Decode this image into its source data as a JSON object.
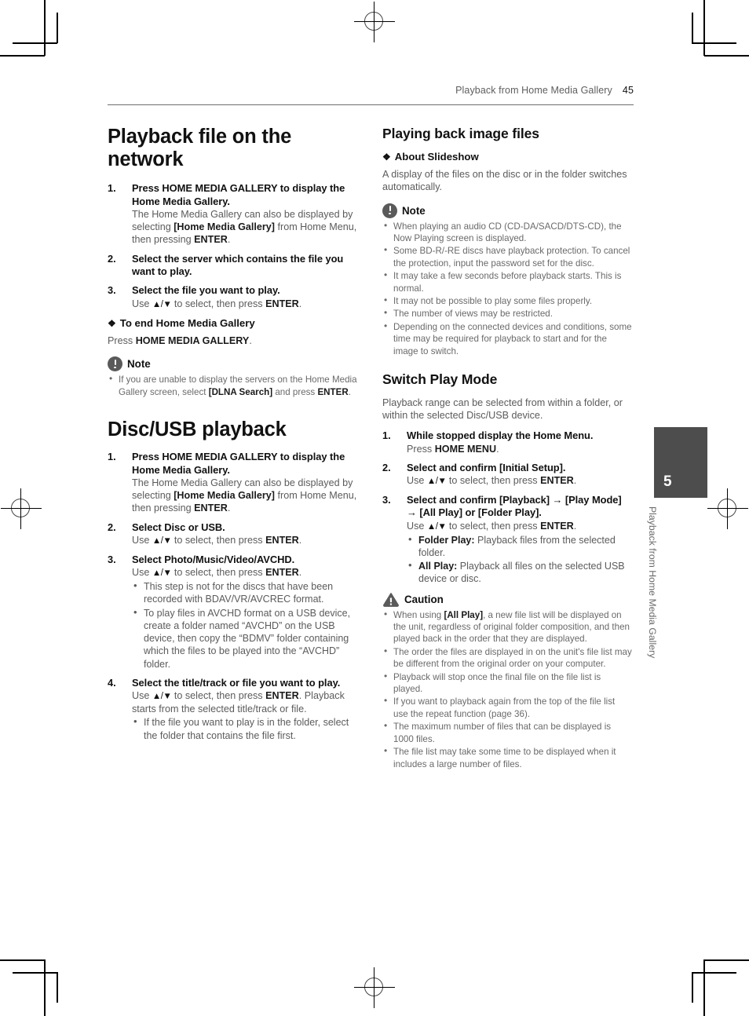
{
  "header": {
    "chapter_title": "Playback from Home Media Gallery",
    "page_number": "45"
  },
  "side_tab": {
    "chapter_number": "5",
    "chapter_label": "Playback from Home Media Gallery",
    "color": "#4d4d4d"
  },
  "left_column": {
    "heading_network": "Playback file on the network",
    "steps_network": [
      {
        "num": "1.",
        "title": "Press HOME MEDIA GALLERY to display the Home Media Gallery.",
        "body_parts": [
          {
            "t": "The Home Media Gallery can also be displayed by selecting ",
            "b": false
          },
          {
            "t": "[Home Media Gallery]",
            "b": true
          },
          {
            "t": " from Home Menu, then pressing ",
            "b": false
          },
          {
            "t": "ENTER",
            "b": true
          },
          {
            "t": ".",
            "b": false
          }
        ]
      },
      {
        "num": "2.",
        "title": "Select the server which contains the file you want to play.",
        "body_parts": []
      },
      {
        "num": "3.",
        "title": "Select the file you want to play.",
        "body_parts": [
          {
            "t": "Use ",
            "b": false
          },
          {
            "t": "ARROWS",
            "b": false,
            "arrows": true
          },
          {
            "t": " to select, then press ",
            "b": false
          },
          {
            "t": "ENTER",
            "b": true
          },
          {
            "t": ".",
            "b": false
          }
        ]
      }
    ],
    "to_end_heading": "To end Home Media Gallery",
    "to_end_body_parts": [
      {
        "t": "Press ",
        "b": false
      },
      {
        "t": "HOME MEDIA GALLERY",
        "b": true
      },
      {
        "t": ".",
        "b": false
      }
    ],
    "note_label": "Note",
    "note_items": [
      [
        {
          "t": "If you are unable to display the servers on the Home Media Gallery screen, select ",
          "b": false
        },
        {
          "t": "[DLNA Search]",
          "b": true
        },
        {
          "t": " and press ",
          "b": false
        },
        {
          "t": "ENTER",
          "b": true
        },
        {
          "t": ".",
          "b": false
        }
      ]
    ],
    "heading_discusb": "Disc/USB playback",
    "steps_discusb": [
      {
        "num": "1.",
        "title": "Press HOME MEDIA GALLERY to display the Home Media Gallery.",
        "body_parts": [
          {
            "t": "The Home Media Gallery can also be displayed by selecting ",
            "b": false
          },
          {
            "t": "[Home Media Gallery]",
            "b": true
          },
          {
            "t": " from Home Menu, then pressing ",
            "b": false
          },
          {
            "t": "ENTER",
            "b": true
          },
          {
            "t": ".",
            "b": false
          }
        ],
        "bullets": []
      },
      {
        "num": "2.",
        "title": "Select Disc or USB.",
        "body_parts": [
          {
            "t": "Use ",
            "b": false
          },
          {
            "t": "ARROWS",
            "b": false,
            "arrows": true
          },
          {
            "t": " to select, then press ",
            "b": false
          },
          {
            "t": "ENTER",
            "b": true
          },
          {
            "t": ".",
            "b": false
          }
        ],
        "bullets": []
      },
      {
        "num": "3.",
        "title": "Select Photo/Music/Video/AVCHD.",
        "body_parts": [
          {
            "t": "Use ",
            "b": false
          },
          {
            "t": "ARROWS",
            "b": false,
            "arrows": true
          },
          {
            "t": " to select, then press ",
            "b": false
          },
          {
            "t": "ENTER",
            "b": true
          },
          {
            "t": ".",
            "b": false
          }
        ],
        "bullets": [
          [
            {
              "t": "This step is not for the discs that have been recorded with BDAV/VR/AVCREC format.",
              "b": false
            }
          ],
          [
            {
              "t": "To play files in AVCHD format on a USB device, create a folder named “AVCHD” on the USB device, then copy the “BDMV” folder containing which the files to be played into the “AVCHD” folder.",
              "b": false
            }
          ]
        ]
      },
      {
        "num": "4.",
        "title": "Select the title/track or file you want to play.",
        "body_parts": [
          {
            "t": "Use ",
            "b": false
          },
          {
            "t": "ARROWS",
            "b": false,
            "arrows": true
          },
          {
            "t": " to select, then press ",
            "b": false
          },
          {
            "t": "ENTER",
            "b": true
          },
          {
            "t": ". Playback starts from the selected title/track or file.",
            "b": false
          }
        ],
        "bullets": [
          [
            {
              "t": "If the file you want to play is in the folder, select the folder that contains the file first.",
              "b": false
            }
          ]
        ]
      }
    ]
  },
  "right_column": {
    "heading_image_files": "Playing back image files",
    "about_slideshow_heading": "About Slideshow",
    "about_slideshow_body": "A display of the files on the disc or in the folder switches automatically.",
    "note_label": "Note",
    "note_items": [
      [
        {
          "t": "When playing an audio CD (CD-DA/SACD/DTS-CD), the Now Playing screen is displayed.",
          "b": false
        }
      ],
      [
        {
          "t": "Some BD-R/-RE discs have playback protection. To cancel the protection, input the password set for the disc.",
          "b": false
        }
      ],
      [
        {
          "t": "It may take a few seconds before playback starts. This is normal.",
          "b": false
        }
      ],
      [
        {
          "t": "It may not be possible to play some files properly.",
          "b": false
        }
      ],
      [
        {
          "t": "The number of views may be restricted.",
          "b": false
        }
      ],
      [
        {
          "t": "Depending on the connected devices and conditions, some time may be required for playback to start and for the image to switch.",
          "b": false
        }
      ]
    ],
    "heading_switch_play_mode": "Switch Play Mode",
    "switch_intro": "Playback range can be selected from within a folder, or within the selected Disc/USB device.",
    "steps_switch": [
      {
        "num": "1.",
        "title": "While stopped display the Home Menu.",
        "body_parts": [
          {
            "t": "Press ",
            "b": false
          },
          {
            "t": "HOME MENU",
            "b": true
          },
          {
            "t": ".",
            "b": false
          }
        ],
        "bullets": []
      },
      {
        "num": "2.",
        "title": "Select and confirm [Initial Setup].",
        "body_parts": [
          {
            "t": "Use ",
            "b": false
          },
          {
            "t": "ARROWS",
            "b": false,
            "arrows": true
          },
          {
            "t": " to select, then press ",
            "b": false
          },
          {
            "t": "ENTER",
            "b": true
          },
          {
            "t": ".",
            "b": false
          }
        ],
        "bullets": []
      },
      {
        "num": "3.",
        "title": "Select and confirm [Playback] → [Play Mode] → [All Play] or [Folder Play].",
        "body_parts": [
          {
            "t": "Use ",
            "b": false
          },
          {
            "t": "ARROWS",
            "b": false,
            "arrows": true
          },
          {
            "t": " to select, then press ",
            "b": false
          },
          {
            "t": "ENTER",
            "b": true
          },
          {
            "t": ".",
            "b": false
          }
        ],
        "bullets": [
          [
            {
              "t": "Folder Play:",
              "b": true
            },
            {
              "t": " Playback files from the selected folder.",
              "b": false
            }
          ],
          [
            {
              "t": "All Play:",
              "b": true
            },
            {
              "t": " Playback all files on the selected USB device or disc.",
              "b": false
            }
          ]
        ]
      }
    ],
    "caution_label": "Caution",
    "caution_items": [
      [
        {
          "t": "When using ",
          "b": false
        },
        {
          "t": "[All Play]",
          "b": true
        },
        {
          "t": ", a new file list will be displayed on the unit, regardless of original folder composition, and then played back in the order that they are displayed.",
          "b": false
        }
      ],
      [
        {
          "t": "The order the files are displayed in on the unit's file list may be different from the original order on your computer.",
          "b": false
        }
      ],
      [
        {
          "t": "Playback will stop once the final file on the file list is played.",
          "b": false
        }
      ],
      [
        {
          "t": "If you want to playback again from the top of the file list use the repeat function (page 36).",
          "b": false
        }
      ],
      [
        {
          "t": "The maximum number of files that can be displayed is 1000 files.",
          "b": false
        }
      ],
      [
        {
          "t": "The file list may take some time to be displayed when it includes a large number of files.",
          "b": false
        }
      ]
    ]
  }
}
